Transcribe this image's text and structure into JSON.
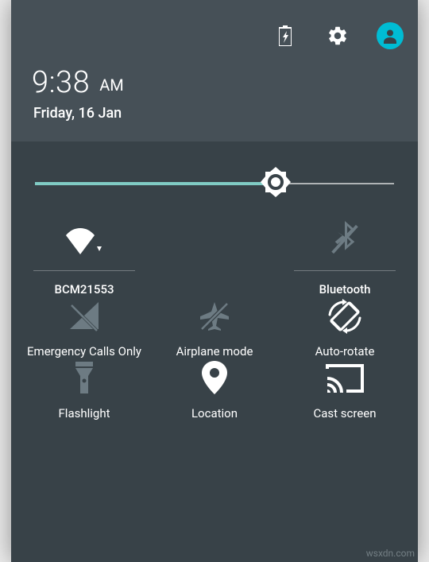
{
  "header": {
    "time": "9:38",
    "ampm": "AM",
    "date": "Friday, 16 Jan"
  },
  "brightness": {
    "percent": 67
  },
  "tiles": {
    "wifi": {
      "label": "BCM21553"
    },
    "bluetooth": {
      "label": "Bluetooth"
    },
    "cellular": {
      "label": "Emergency Calls Only"
    },
    "airplane": {
      "label": "Airplane mode"
    },
    "autorotate": {
      "label": "Auto-rotate"
    },
    "flashlight": {
      "label": "Flashlight"
    },
    "location": {
      "label": "Location"
    },
    "cast": {
      "label": "Cast screen"
    }
  },
  "watermark": "wsxdn.com"
}
